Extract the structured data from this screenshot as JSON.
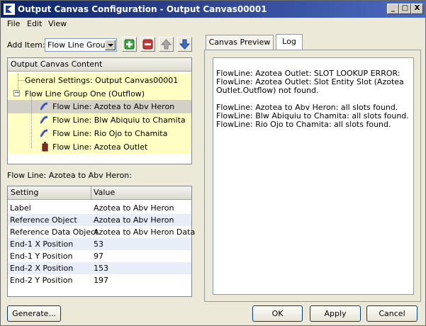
{
  "window": {
    "title": "Output Canvas Configuration - Output Canvas00001",
    "minimize": "_",
    "maximize": "□",
    "close": "X"
  },
  "menu": [
    "File",
    "Edit",
    "View"
  ],
  "add_item": {
    "label": "Add Item:",
    "selected": "Flow Line Group"
  },
  "tree": {
    "header": "Output Canvas Content",
    "items": [
      {
        "label": "General Settings: Output Canvas00001"
      },
      {
        "label": "Flow Line Group One (Outflow)"
      },
      {
        "label": "Flow Line: Azotea to Abv Heron",
        "selected": true
      },
      {
        "label": "Flow Line: Blw Abiquiu to Chamita"
      },
      {
        "label": "Flow Line: Rio Ojo to Chamita"
      },
      {
        "label": "Flow Line: Azotea Outlet"
      }
    ]
  },
  "details": {
    "title": "Flow Line: Azotea to Abv Heron:",
    "columns": [
      "Setting",
      "Value"
    ],
    "rows": [
      [
        "Label",
        "Azotea to Abv Heron"
      ],
      [
        "Reference Object",
        "Azotea to Abv Heron"
      ],
      [
        "Reference Data Object",
        "Azotea to Abv Heron Data"
      ],
      [
        "End-1 X Position",
        "53"
      ],
      [
        "End-1 Y Position",
        "97"
      ],
      [
        "End-2 X Position",
        "153"
      ],
      [
        "End-2 Y Position",
        "197"
      ]
    ]
  },
  "tabs": [
    "Canvas Preview",
    "Log"
  ],
  "active_tab": "Log",
  "log_lines": [
    "FlowLine: Azotea Outlet: SLOT LOOKUP ERROR:",
    "FlowLine: Azotea Outlet: Slot Entity Slot (Azotea",
    "Outlet.Outflow) not found.",
    "",
    "FlowLine: Azotea to Abv Heron: all slots found.",
    "FlowLine: Blw Abiquiu to Chamita: all slots found.",
    "FlowLine: Rio Ojo to Chamita: all slots found."
  ],
  "buttons": {
    "generate": "Generate...",
    "ok": "OK",
    "apply": "Apply",
    "cancel": "Cancel"
  },
  "colors": {
    "title_start": "#0a246a",
    "tree_highlight": "#ffffc4",
    "selection": "#d4d0c8",
    "table_alt": "#e8eef8"
  }
}
